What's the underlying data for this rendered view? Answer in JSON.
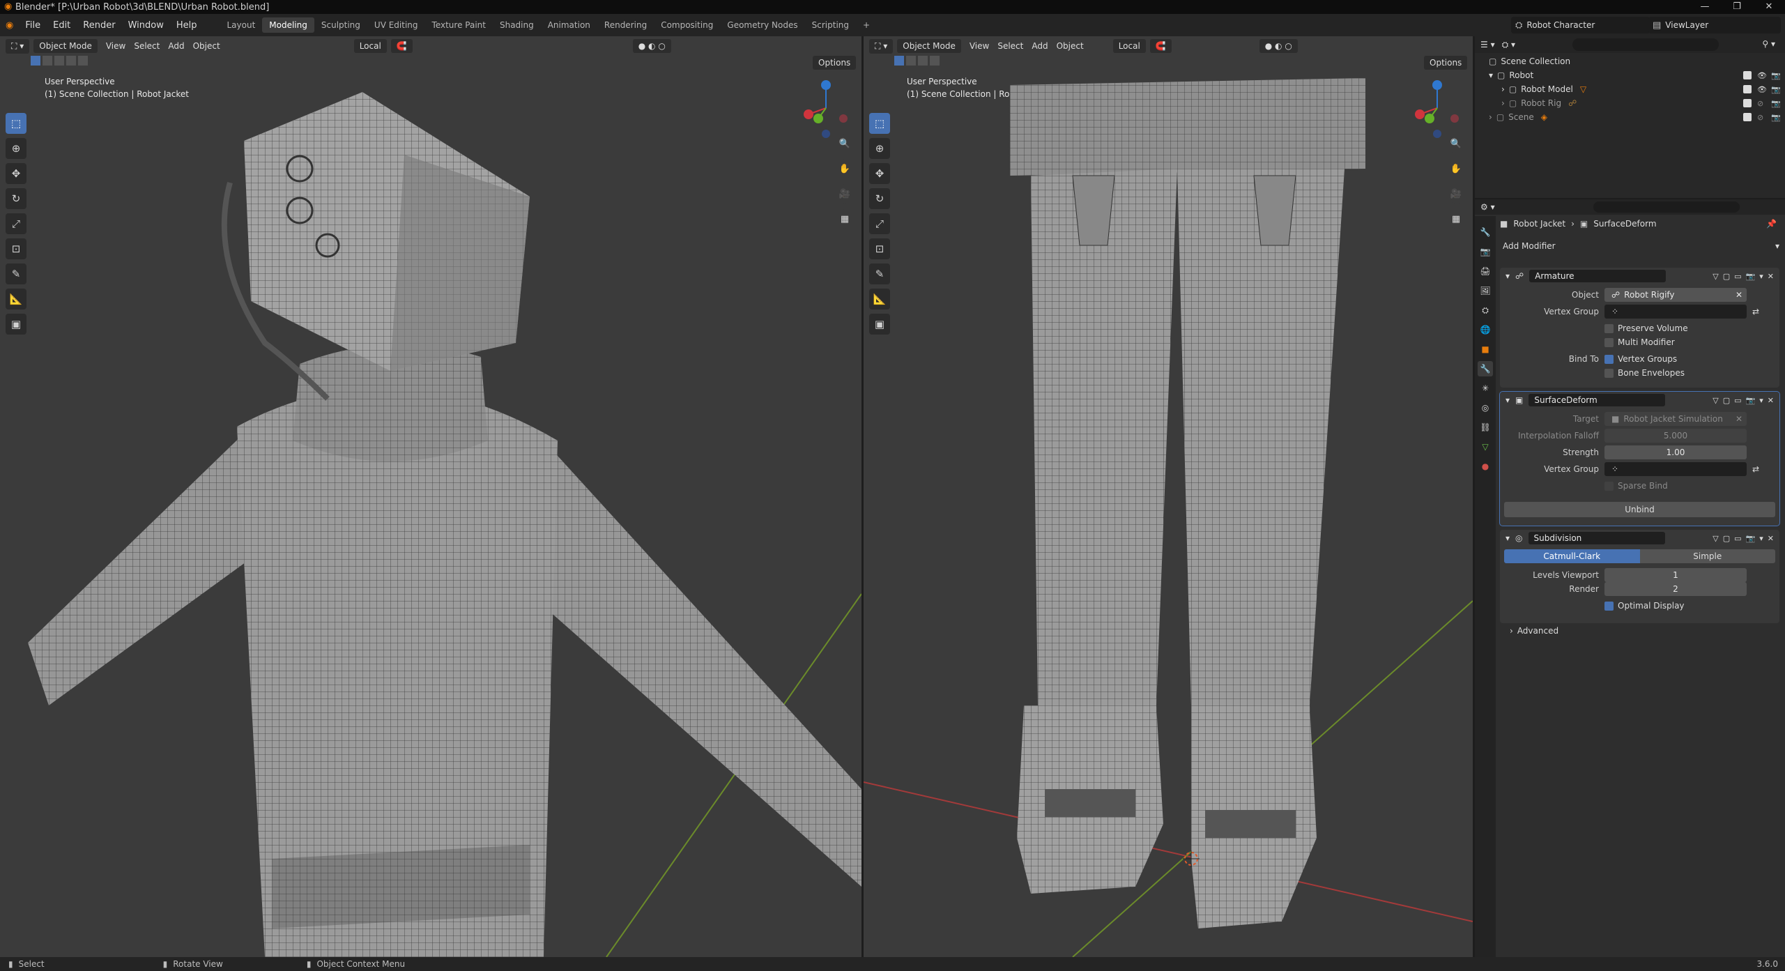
{
  "window": {
    "title": "Blender* [P:\\Urban Robot\\3d\\BLEND\\Urban Robot.blend]",
    "controls": [
      "—",
      "❐",
      "✕"
    ]
  },
  "menu": [
    "File",
    "Edit",
    "Render",
    "Window",
    "Help"
  ],
  "workspaces": [
    "Layout",
    "Modeling",
    "Sculpting",
    "UV Editing",
    "Texture Paint",
    "Shading",
    "Animation",
    "Rendering",
    "Compositing",
    "Geometry Nodes",
    "Scripting",
    "+"
  ],
  "active_workspace": "Modeling",
  "scene_name": "Robot Character",
  "view_layer": "ViewLayer",
  "viewport_left": {
    "mode": "Object Mode",
    "menus": [
      "View",
      "Select",
      "Add",
      "Object"
    ],
    "orientation": "Local",
    "options": "Options",
    "perspective": "User Perspective",
    "collection": "(1) Scene Collection | Robot Jacket"
  },
  "viewport_right": {
    "mode": "Object Mode",
    "menus": [
      "View",
      "Select",
      "Add",
      "Object"
    ],
    "orientation": "Local",
    "options": "Options",
    "perspective": "User Perspective",
    "collection": "(1) Scene Collection | Robot Jacket"
  },
  "outliner": {
    "root": "Scene Collection",
    "items": [
      {
        "label": "Robot"
      },
      {
        "label": "Robot Model"
      },
      {
        "label": "Robot Rig"
      },
      {
        "label": "Scene"
      }
    ]
  },
  "properties": {
    "breadcrumb_object": "Robot Jacket",
    "breadcrumb_modifier": "SurfaceDeform",
    "add_modifier": "Add Modifier",
    "armature": {
      "name": "Armature",
      "object_label": "Object",
      "object_value": "Robot Rigify",
      "vertex_group_label": "Vertex Group",
      "preserve_volume": "Preserve Volume",
      "multi_modifier": "Multi Modifier",
      "bind_to_label": "Bind To",
      "vertex_groups": "Vertex Groups",
      "bone_envelopes": "Bone Envelopes"
    },
    "surface_deform": {
      "name": "SurfaceDeform",
      "target_label": "Target",
      "target_value": "Robot Jacket Simulation",
      "falloff_label": "Interpolation Falloff",
      "falloff_value": "5.000",
      "strength_label": "Strength",
      "strength_value": "1.00",
      "vertex_group_label": "Vertex Group",
      "sparse_bind": "Sparse Bind",
      "unbind": "Unbind"
    },
    "subdivision": {
      "name": "Subdivision",
      "catmull": "Catmull-Clark",
      "simple": "Simple",
      "levels_label": "Levels Viewport",
      "levels_value": "1",
      "render_label": "Render",
      "render_value": "2",
      "optimal_display": "Optimal Display",
      "advanced": "Advanced"
    }
  },
  "statusbar": {
    "select": "Select",
    "rotate": "Rotate View",
    "context": "Object Context Menu",
    "version": "3.6.0"
  },
  "colors": {
    "accent": "#4772b3",
    "viewport_bg": "#3b3b3b",
    "mesh": "#8a8a8a"
  }
}
